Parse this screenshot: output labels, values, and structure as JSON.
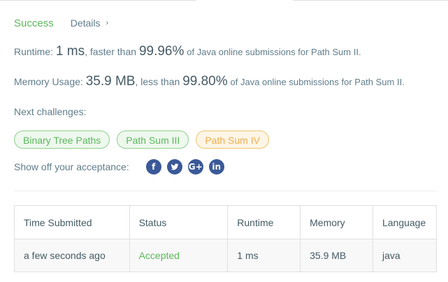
{
  "result": {
    "status": "Success",
    "details_label": "Details",
    "details_chevron": "›"
  },
  "runtime": {
    "label": "Runtime:",
    "value": "1 ms",
    "comparison": ", faster than",
    "percent": "99.96%",
    "suffix": "of Java online submissions for Path Sum II."
  },
  "memory": {
    "label": "Memory Usage:",
    "value": "35.9 MB",
    "comparison": ", less than",
    "percent": "99.80%",
    "suffix": "of Java online submissions for Path Sum II."
  },
  "next": {
    "label": "Next challenges:",
    "challenges": [
      {
        "label": "Binary Tree Paths",
        "difficulty": "easy"
      },
      {
        "label": "Path Sum III",
        "difficulty": "easy"
      },
      {
        "label": "Path Sum IV",
        "difficulty": "medium"
      }
    ]
  },
  "share": {
    "label": "Show off your acceptance:",
    "icons": [
      "facebook-icon",
      "twitter-icon",
      "google-plus-icon",
      "linkedin-icon"
    ],
    "glyphs": [
      "f",
      "t",
      "G+",
      "in"
    ]
  },
  "table": {
    "headers": [
      "Time Submitted",
      "Status",
      "Runtime",
      "Memory",
      "Language"
    ],
    "rows": [
      [
        "a few seconds ago",
        "Accepted",
        "1 ms",
        "35.9 MB",
        "java"
      ]
    ]
  },
  "colors": {
    "success": "#5cb85c",
    "social": "#3b5998",
    "medium_tag": "#f0ad4e"
  }
}
